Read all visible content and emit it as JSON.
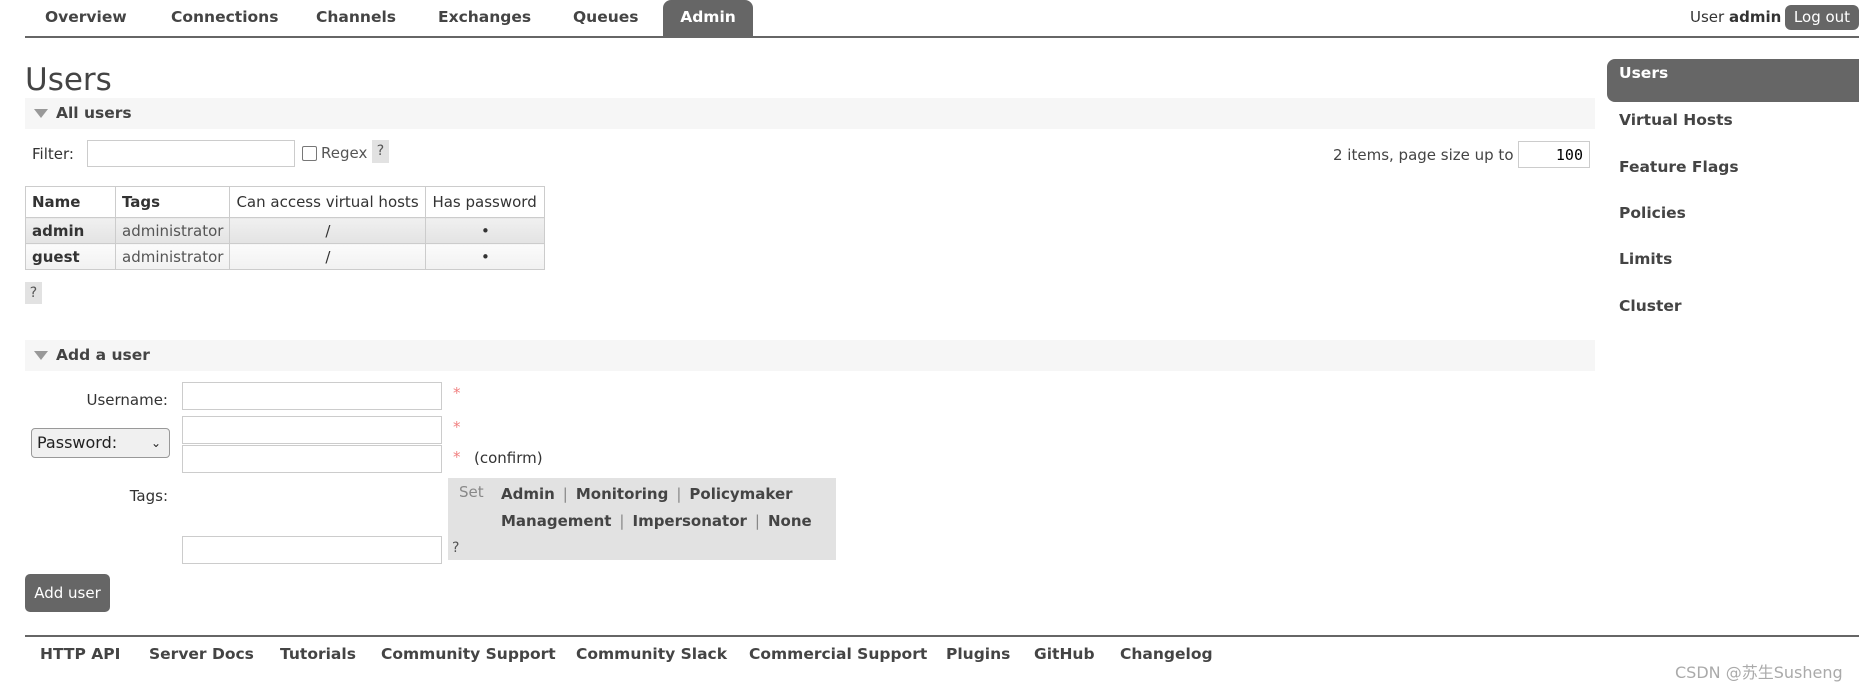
{
  "nav": {
    "tabs": [
      {
        "label": "Overview"
      },
      {
        "label": "Connections"
      },
      {
        "label": "Channels"
      },
      {
        "label": "Exchanges"
      },
      {
        "label": "Queues"
      },
      {
        "label": "Admin",
        "active": true
      }
    ],
    "user_prefix": "User",
    "user_name": "admin",
    "logout_label": "Log out"
  },
  "page_title": "Users",
  "all_users": {
    "section_label": "All users",
    "filter_label": "Filter:",
    "filter_value": "",
    "regex_label": "Regex",
    "regex_checked": false,
    "help": "?",
    "items_text": "2 items, page size up to",
    "page_size": "100",
    "table": {
      "columns": [
        "Name",
        "Tags",
        "Can access virtual hosts",
        "Has password"
      ],
      "rows": [
        {
          "name": "admin",
          "tags": "administrator",
          "vhosts": "/",
          "has_password": "•"
        },
        {
          "name": "guest",
          "tags": "administrator",
          "vhosts": "/",
          "has_password": "•"
        }
      ]
    }
  },
  "add_user": {
    "section_label": "Add a user",
    "username_label": "Username:",
    "required_mark": "*",
    "password_select": "Password:",
    "confirm_label": "(confirm)",
    "tags_label": "Tags:",
    "set_label": "Set",
    "tag_options": [
      "Admin",
      "Monitoring",
      "Policymaker",
      "Management",
      "Impersonator",
      "None"
    ],
    "help": "?",
    "submit_label": "Add user"
  },
  "sidebar": {
    "items": [
      {
        "label": "Users",
        "active": true
      },
      {
        "label": "Virtual Hosts"
      },
      {
        "label": "Feature Flags"
      },
      {
        "label": "Policies"
      },
      {
        "label": "Limits"
      },
      {
        "label": "Cluster"
      }
    ]
  },
  "footer": {
    "links": [
      "HTTP API",
      "Server Docs",
      "Tutorials",
      "Community Support",
      "Community Slack",
      "Commercial Support",
      "Plugins",
      "GitHub",
      "Changelog"
    ]
  },
  "watermark": "CSDN @苏生Susheng",
  "colors": {
    "accent": "#666666",
    "required": "#f08080",
    "section_bg": "#f6f6f6"
  }
}
